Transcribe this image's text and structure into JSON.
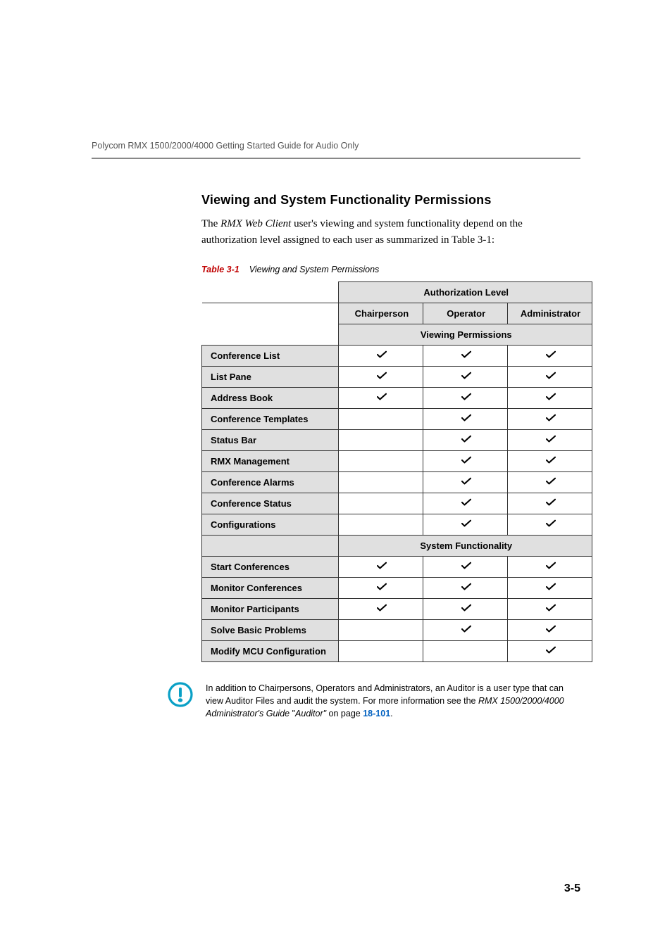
{
  "header": "Polycom RMX 1500/2000/4000 Getting Started Guide for Audio Only",
  "heading": "Viewing and System Functionality Permissions",
  "intro_pre": "The ",
  "intro_italic": "RMX Web Client",
  "intro_post": " user's viewing and system functionality depend on the authorization level assigned to each user as summarized in Table 3-1:",
  "table_caption_num": "Table 3-1",
  "table_caption_title": "Viewing and System Permissions",
  "cols": {
    "auth_level": "Authorization Level",
    "chairperson": "Chairperson",
    "operator": "Operator",
    "administrator": "Administrator",
    "viewing": "Viewing Permissions",
    "system": "System Functionality"
  },
  "rows": [
    {
      "label": "Conference List",
      "ch": true,
      "op": true,
      "ad": true
    },
    {
      "label": "List Pane",
      "ch": true,
      "op": true,
      "ad": true
    },
    {
      "label": "Address Book",
      "ch": true,
      "op": true,
      "ad": true
    },
    {
      "label": "Conference Templates",
      "ch": false,
      "op": true,
      "ad": true
    },
    {
      "label": "Status Bar",
      "ch": false,
      "op": true,
      "ad": true
    },
    {
      "label": "RMX Management",
      "ch": false,
      "op": true,
      "ad": true
    },
    {
      "label": "Conference Alarms",
      "ch": false,
      "op": true,
      "ad": true
    },
    {
      "label": "Conference Status",
      "ch": false,
      "op": true,
      "ad": true
    },
    {
      "label": "Configurations",
      "ch": false,
      "op": true,
      "ad": true
    }
  ],
  "rows2": [
    {
      "label": "Start Conferences",
      "ch": true,
      "op": true,
      "ad": true
    },
    {
      "label": "Monitor Conferences",
      "ch": true,
      "op": true,
      "ad": true
    },
    {
      "label": "Monitor Participants",
      "ch": true,
      "op": true,
      "ad": true
    },
    {
      "label": "Solve Basic Problems",
      "ch": false,
      "op": true,
      "ad": true
    },
    {
      "label": "Modify MCU Configuration",
      "ch": false,
      "op": false,
      "ad": true
    }
  ],
  "note_p1": "In addition to Chairpersons, Operators and Administrators, an Auditor is a user type that can view Auditor Files and audit the system. For more information see the ",
  "note_italic1": "RMX 1500/2000/4000 Administrator's Guide",
  "note_mid": " \"",
  "note_italic2": "Auditor\"",
  "note_after": " on page ",
  "note_link": "18-101",
  "note_period": ".",
  "page_num": "3-5",
  "chart_data": {
    "type": "table",
    "title": "Viewing and System Permissions",
    "columns": [
      "Chairperson",
      "Operator",
      "Administrator"
    ],
    "sections": [
      {
        "name": "Viewing Permissions",
        "rows": [
          {
            "label": "Conference List",
            "values": [
              true,
              true,
              true
            ]
          },
          {
            "label": "List Pane",
            "values": [
              true,
              true,
              true
            ]
          },
          {
            "label": "Address Book",
            "values": [
              true,
              true,
              true
            ]
          },
          {
            "label": "Conference Templates",
            "values": [
              false,
              true,
              true
            ]
          },
          {
            "label": "Status Bar",
            "values": [
              false,
              true,
              true
            ]
          },
          {
            "label": "RMX Management",
            "values": [
              false,
              true,
              true
            ]
          },
          {
            "label": "Conference Alarms",
            "values": [
              false,
              true,
              true
            ]
          },
          {
            "label": "Conference Status",
            "values": [
              false,
              true,
              true
            ]
          },
          {
            "label": "Configurations",
            "values": [
              false,
              true,
              true
            ]
          }
        ]
      },
      {
        "name": "System Functionality",
        "rows": [
          {
            "label": "Start Conferences",
            "values": [
              true,
              true,
              true
            ]
          },
          {
            "label": "Monitor Conferences",
            "values": [
              true,
              true,
              true
            ]
          },
          {
            "label": "Monitor Participants",
            "values": [
              true,
              true,
              true
            ]
          },
          {
            "label": "Solve Basic Problems",
            "values": [
              false,
              true,
              true
            ]
          },
          {
            "label": "Modify MCU Configuration",
            "values": [
              false,
              false,
              true
            ]
          }
        ]
      }
    ]
  }
}
